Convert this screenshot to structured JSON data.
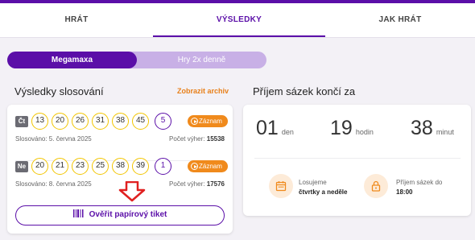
{
  "tabs": [
    {
      "label": "HRÁT"
    },
    {
      "label": "VÝSLEDKY"
    },
    {
      "label": "JAK HRÁT"
    }
  ],
  "toggle": {
    "active": "Megamaxa",
    "inactive": "Hry 2x denně"
  },
  "results": {
    "title": "Výsledky slosování",
    "archive_link": "Zobrazit archiv",
    "draws": [
      {
        "day": "Čt",
        "numbers": [
          "13",
          "20",
          "26",
          "31",
          "38",
          "45"
        ],
        "bonus": "5",
        "record_label": "Záznam",
        "drawn_text": "Slosováno: 5. června 2025",
        "wins_label": "Počet výher:",
        "wins_value": "15538"
      },
      {
        "day": "Ne",
        "numbers": [
          "20",
          "21",
          "23",
          "25",
          "38",
          "39"
        ],
        "bonus": "1",
        "record_label": "Záznam",
        "drawn_text": "Slosováno: 8. června 2025",
        "wins_label": "Počet výher:",
        "wins_value": "17576"
      }
    ],
    "verify_button": "Ověřit papírový tiket"
  },
  "countdown": {
    "title": "Příjem sázek končí za",
    "days": {
      "value": "01",
      "unit": "den"
    },
    "hours": {
      "value": "19",
      "unit": "hodin"
    },
    "minutes": {
      "value": "38",
      "unit": "minut"
    },
    "draw_label": "Losujeme",
    "draw_value": "čtvrtky a neděle",
    "deadline_label": "Příjem sázek do",
    "deadline_value": "18:00"
  },
  "colors": {
    "accent": "#5b0fa8",
    "orange": "#f08a1c",
    "ball_border": "#f2c500"
  },
  "icons": [
    "play-icon",
    "barcode-icon",
    "calendar-icon",
    "lock-icon",
    "arrow-down-icon"
  ]
}
